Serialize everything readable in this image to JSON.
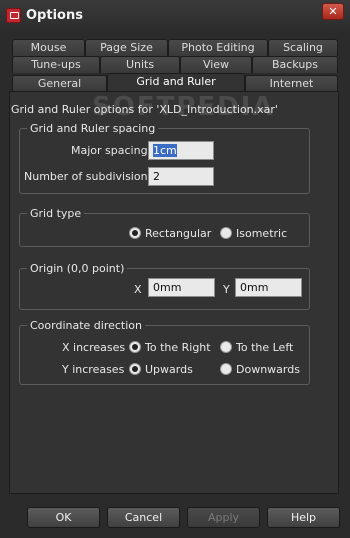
{
  "window": {
    "title": "Options"
  },
  "tabs": {
    "row1": [
      "Mouse",
      "Page Size",
      "Photo Editing",
      "Scaling"
    ],
    "row2": [
      "Tune-ups",
      "Units",
      "View",
      "Backups"
    ],
    "row3": [
      "General",
      "Grid and Ruler",
      "Internet"
    ],
    "active": "Grid and Ruler"
  },
  "panel": {
    "heading": "Grid and Ruler options for 'XLD_Introduction.xar'",
    "watermark": "SOFTPEDIA",
    "spacing": {
      "legend": "Grid and Ruler spacing",
      "major_label": "Major spacing",
      "major_value": "1cm",
      "subdiv_label": "Number of subdivisions",
      "subdiv_value": "2"
    },
    "grid_type": {
      "legend": "Grid type",
      "options": [
        "Rectangular",
        "Isometric"
      ],
      "selected": "Rectangular"
    },
    "origin": {
      "legend": "Origin (0,0 point)",
      "x_label": "X",
      "x_value": "0mm",
      "y_label": "Y",
      "y_value": "0mm"
    },
    "coords": {
      "legend": "Coordinate direction",
      "x_label": "X increases",
      "x_options": [
        "To the Right",
        "To the Left"
      ],
      "x_selected": "To the Right",
      "y_label": "Y increases",
      "y_options": [
        "Upwards",
        "Downwards"
      ],
      "y_selected": "Upwards"
    }
  },
  "buttons": {
    "ok": "OK",
    "cancel": "Cancel",
    "apply": "Apply",
    "help": "Help"
  },
  "icons": {
    "app": "app-icon",
    "close": "close-icon",
    "close_glyph": "✕"
  }
}
